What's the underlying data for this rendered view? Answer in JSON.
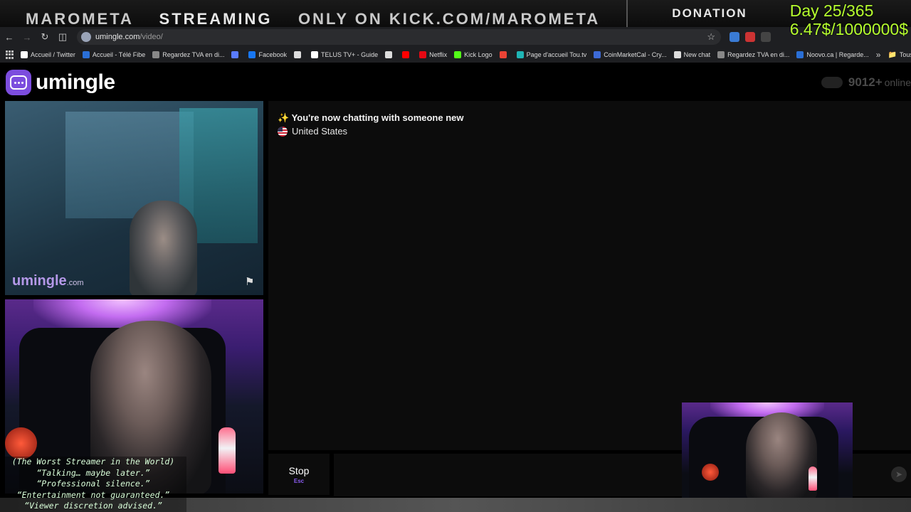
{
  "overlay": {
    "marquee_prefix": "MAROMETA",
    "marquee_highlight": "STREAMING",
    "marquee_suffix": "ONLY ON KICK.COM/MAROMETA",
    "donation_label": "DONATION",
    "day_counter": "Day 25/365",
    "donation_progress": "6.47$/1000000$",
    "captions": [
      "(The Worst Streamer in the World)",
      "“Talking… maybe later.”",
      "“Professional silence.”",
      "“Entertainment not guaranteed.”",
      "“Viewer discretion advised.”"
    ]
  },
  "browser": {
    "url_host": "umingle.com",
    "url_path": "/video/",
    "bookmarks": [
      {
        "label": "Accueil / Twitter",
        "icon": "x-icon",
        "color": "#ffffff"
      },
      {
        "label": "Accueil - Télé Fibe",
        "icon": "bell-icon",
        "color": "#2a6fd6"
      },
      {
        "label": "Regardez TVA en di...",
        "icon": "tva-icon",
        "color": "#888888"
      },
      {
        "label": "",
        "icon": "circle-icon",
        "color": "#5a7cff"
      },
      {
        "label": "Facebook",
        "icon": "facebook-icon",
        "color": "#1877f2"
      },
      {
        "label": "",
        "icon": "s-icon",
        "color": "#dddddd"
      },
      {
        "label": "TELUS TV+ - Guide",
        "icon": "play-icon",
        "color": "#ffffff"
      },
      {
        "label": "",
        "icon": "s-icon",
        "color": "#dddddd"
      },
      {
        "label": "",
        "icon": "youtube-icon",
        "color": "#ff0000"
      },
      {
        "label": "Netflix",
        "icon": "netflix-icon",
        "color": "#e50914"
      },
      {
        "label": "Kick Logo",
        "icon": "kick-icon",
        "color": "#53fc18"
      },
      {
        "label": "",
        "icon": "gmail-icon",
        "color": "#ea4335"
      },
      {
        "label": "Page d'accueil Tou.tv",
        "icon": "toutv-icon",
        "color": "#1fb5b5"
      },
      {
        "label": "CoinMarketCal - Cry...",
        "icon": "coin-icon",
        "color": "#3d6ad6"
      },
      {
        "label": "New chat",
        "icon": "openai-icon",
        "color": "#dddddd"
      },
      {
        "label": "Regardez TVA en di...",
        "icon": "tva-icon",
        "color": "#888888"
      },
      {
        "label": "Noovo.ca | Regarde...",
        "icon": "noovo-icon",
        "color": "#2a6fd6"
      }
    ],
    "favorites_label": "Tous les favoris"
  },
  "app": {
    "logo_text": "umingle",
    "online_count": "9012+",
    "online_label": "online",
    "watermark_main": "umingle",
    "watermark_suffix": ".com",
    "chat_status": "✨ You're now chatting with someone new",
    "country": "United States",
    "stop_label": "Stop",
    "stop_key": "Esc",
    "brand_color": "#7c4dde"
  }
}
